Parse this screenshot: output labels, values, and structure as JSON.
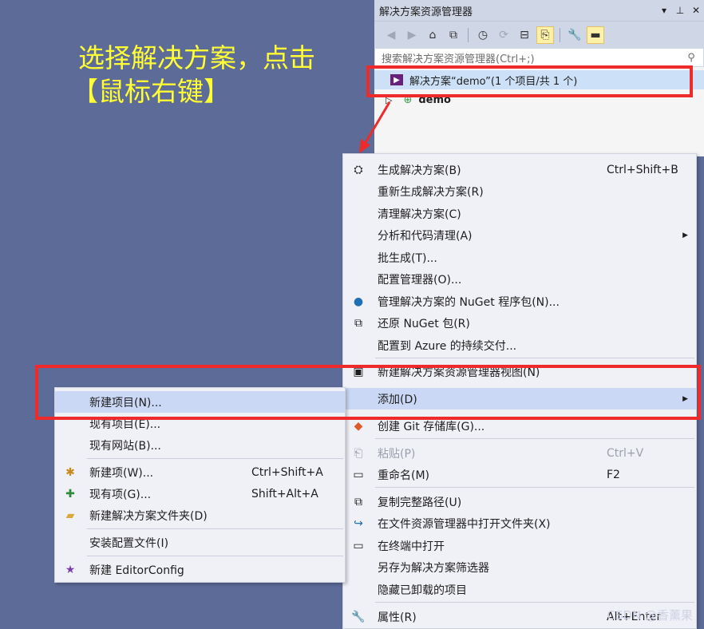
{
  "annotation": {
    "line1": "选择解决方案，点击",
    "line2": "【鼠标右键】"
  },
  "panel": {
    "title": "解决方案资源管理器",
    "title_buttons": [
      "▾",
      "⊥",
      "✕"
    ],
    "search_placeholder": "搜索解决方案资源管理器(Ctrl+;)",
    "search_icon": "⚲",
    "toolbar_icons": [
      {
        "name": "back-icon",
        "glyph": "◀",
        "dim": true
      },
      {
        "name": "forward-icon",
        "glyph": "▶",
        "dim": true
      },
      {
        "name": "home-icon",
        "glyph": "⌂",
        "dim": false
      },
      {
        "name": "switch-views-icon",
        "glyph": "⧉",
        "dim": false
      },
      {
        "name": "pending-changes-icon",
        "glyph": "◷",
        "dim": false
      },
      {
        "name": "sync-icon",
        "glyph": "⟳",
        "dim": true
      },
      {
        "name": "collapse-all-icon",
        "glyph": "⊟",
        "dim": false
      },
      {
        "name": "show-all-files-icon",
        "glyph": "⎘",
        "dim": false
      },
      {
        "name": "properties-icon",
        "glyph": "🔧",
        "dim": false
      },
      {
        "name": "preview-icon",
        "glyph": "▬",
        "dim": false
      }
    ],
    "solution_label": "解决方案“demo”(1 个项目/共 1 个)",
    "project_label": "demo"
  },
  "context_menu": {
    "items": [
      {
        "label": "生成解决方案(B)",
        "shortcut": "Ctrl+Shift+B",
        "icon": "build-icon",
        "glyph": "⛭"
      },
      {
        "label": "重新生成解决方案(R)",
        "shortcut": "",
        "icon": "",
        "glyph": ""
      },
      {
        "label": "清理解决方案(C)",
        "shortcut": "",
        "icon": "",
        "glyph": ""
      },
      {
        "label": "分析和代码清理(A)",
        "shortcut": "",
        "icon": "",
        "glyph": "",
        "submenu": true
      },
      {
        "label": "批生成(T)...",
        "shortcut": "",
        "icon": "",
        "glyph": ""
      },
      {
        "label": "配置管理器(O)...",
        "shortcut": "",
        "icon": "",
        "glyph": ""
      },
      {
        "label": "管理解决方案的 NuGet 程序包(N)...",
        "shortcut": "",
        "icon": "nuget-icon",
        "glyph": "●"
      },
      {
        "label": "还原 NuGet 包(R)",
        "shortcut": "",
        "icon": "restore-icon",
        "glyph": "⧉"
      },
      {
        "label": "配置到 Azure 的持续交付...",
        "shortcut": "",
        "icon": "",
        "glyph": ""
      },
      {
        "label": "新建解决方案资源管理器视图(N)",
        "shortcut": "",
        "icon": "new-view-icon",
        "glyph": "▣"
      },
      {
        "label": "添加(D)",
        "shortcut": "",
        "icon": "",
        "glyph": "",
        "submenu": true
      },
      {
        "label": "创建 Git 存储库(G)...",
        "shortcut": "",
        "icon": "git-icon",
        "glyph": "◆"
      },
      {
        "label": "粘贴(P)",
        "shortcut": "Ctrl+V",
        "icon": "paste-icon",
        "glyph": "⎗"
      },
      {
        "label": "重命名(M)",
        "shortcut": "F2",
        "icon": "rename-icon",
        "glyph": "▭"
      },
      {
        "label": "复制完整路径(U)",
        "shortcut": "",
        "icon": "copy-icon",
        "glyph": "⧉"
      },
      {
        "label": "在文件资源管理器中打开文件夹(X)",
        "shortcut": "",
        "icon": "open-folder-icon",
        "glyph": "↪"
      },
      {
        "label": "在终端中打开",
        "shortcut": "",
        "icon": "terminal-icon",
        "glyph": "▭"
      },
      {
        "label": "另存为解决方案筛选器",
        "shortcut": "",
        "icon": "",
        "glyph": ""
      },
      {
        "label": "隐藏已卸载的项目",
        "shortcut": "",
        "icon": "",
        "glyph": ""
      },
      {
        "label": "属性(R)",
        "shortcut": "Alt+Enter",
        "icon": "wrench-icon",
        "glyph": "🔧"
      }
    ]
  },
  "add_submenu": {
    "items": [
      {
        "label": "新建项目(N)...",
        "shortcut": "",
        "icon": "",
        "glyph": ""
      },
      {
        "label": "现有项目(E)...",
        "shortcut": "",
        "icon": "",
        "glyph": ""
      },
      {
        "label": "现有网站(B)...",
        "shortcut": "",
        "icon": "",
        "glyph": ""
      },
      {
        "label": "新建项(W)...",
        "shortcut": "Ctrl+Shift+A",
        "icon": "new-item-icon",
        "glyph": "✱"
      },
      {
        "label": "现有项(G)...",
        "shortcut": "Shift+Alt+A",
        "icon": "existing-item-icon",
        "glyph": "✚"
      },
      {
        "label": "新建解决方案文件夹(D)",
        "shortcut": "",
        "icon": "new-folder-icon",
        "glyph": "▰"
      },
      {
        "label": "安装配置文件(I)",
        "shortcut": "",
        "icon": "",
        "glyph": ""
      },
      {
        "label": "新建 EditorConfig",
        "shortcut": "",
        "icon": "editorconfig-icon",
        "glyph": "★"
      }
    ]
  },
  "watermark": "CSDN @香薰果",
  "colors": {
    "background": "#5d6b99",
    "highlight": "#cbd8f5",
    "annotation_red": "#ee2a2a",
    "annotation_text": "#ffff33"
  }
}
